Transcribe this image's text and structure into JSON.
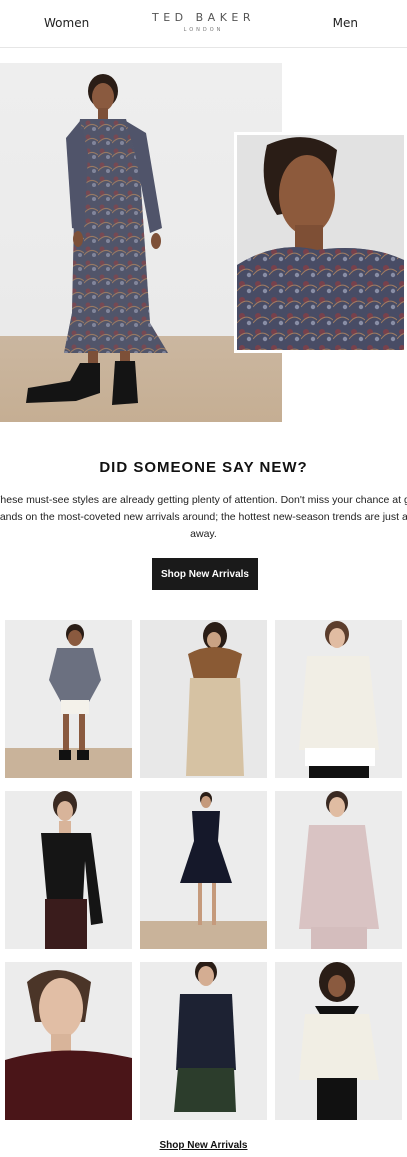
{
  "header": {
    "nav_left": "Women",
    "nav_right": "Men",
    "logo_main": "TED BAKER",
    "logo_sub": "LONDON"
  },
  "hero": {
    "main_image": "model-in-paisley-maxi-dress",
    "side_image": "close-up-paisley-dress"
  },
  "content": {
    "headline": "DID SOMEONE SAY NEW?",
    "body_line1": "These must-see styles are already getting plenty of attention. Don't miss your chance at getting your",
    "body_line2": "hands on the most-coveted new arrivals around; the hottest new-season trends are just a few clicks",
    "body_line3": "away.",
    "cta_label": "Shop New Arrivals"
  },
  "products": [
    {
      "image": "floral-blouse-white-skirt"
    },
    {
      "image": "fur-collar-camel-coat"
    },
    {
      "image": "cream-knit-jumper"
    },
    {
      "image": "black-square-neck-top"
    },
    {
      "image": "navy-skater-dress"
    },
    {
      "image": "pink-hoodie-loungewear"
    },
    {
      "image": "burgundy-metallic-knit"
    },
    {
      "image": "printed-tee-green-skirt"
    },
    {
      "image": "cream-blouse-collar"
    }
  ],
  "footer": {
    "link_label": "Shop New Arrivals"
  },
  "colors": {
    "cta_bg": "#1a1a1a",
    "text": "#111111",
    "divider": "#e6e6e6"
  }
}
